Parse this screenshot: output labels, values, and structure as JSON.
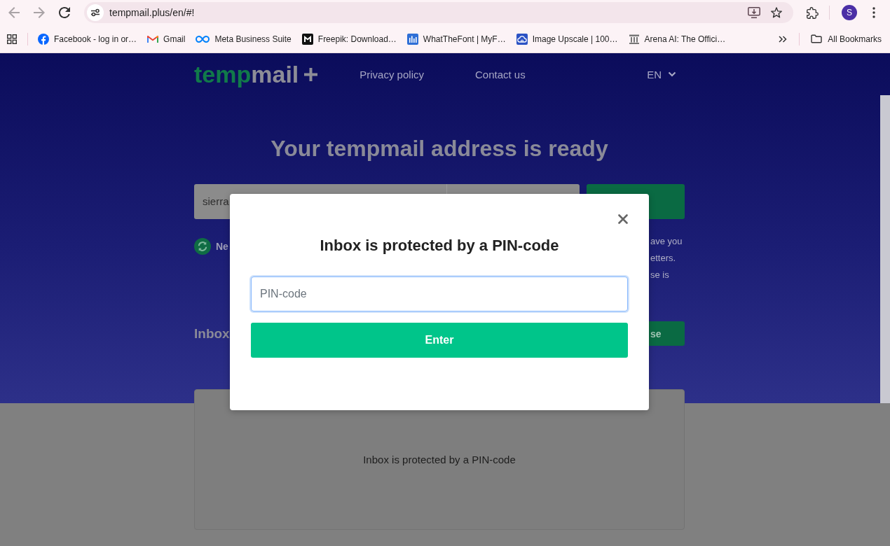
{
  "browser": {
    "nav": [
      {
        "kind": "back",
        "disabled": true
      },
      {
        "kind": "forward",
        "disabled": true
      },
      {
        "kind": "reload",
        "disabled": false
      }
    ],
    "url": "tempmail.plus/en/#!",
    "profile_initial": "S",
    "bookmarks": [
      {
        "kind": "facebook",
        "label": "Facebook - log in or…"
      },
      {
        "kind": "gmail",
        "label": "Gmail"
      },
      {
        "kind": "meta",
        "label": "Meta Business Suite"
      },
      {
        "kind": "freepik",
        "label": "Freepik: Download…"
      },
      {
        "kind": "whatthefont",
        "label": "WhatTheFont | MyF…"
      },
      {
        "kind": "upscale",
        "label": "Image Upscale | 100…"
      },
      {
        "kind": "arena",
        "label": "Arena AI: The Offici…"
      }
    ],
    "all_bookmarks": "All Bookmarks"
  },
  "site": {
    "logo": {
      "accent": "temp",
      "rest": "mail"
    },
    "nav_links": [
      "Privacy policy",
      "Contact us"
    ],
    "language": "EN",
    "headline": "Your tempmail address is ready",
    "email_value": "sierra",
    "notice_left": "Ne",
    "notice_right": [
      "ave you",
      "etters.",
      "se is"
    ],
    "inbox_title": "Inbox",
    "inbox_button": "se",
    "inbox_message": "Inbox is protected by a PIN-code"
  },
  "modal": {
    "title": "Inbox is protected by a PIN-code",
    "pin_field": {
      "placeholder": "PIN-code"
    },
    "submit": "Enter"
  }
}
